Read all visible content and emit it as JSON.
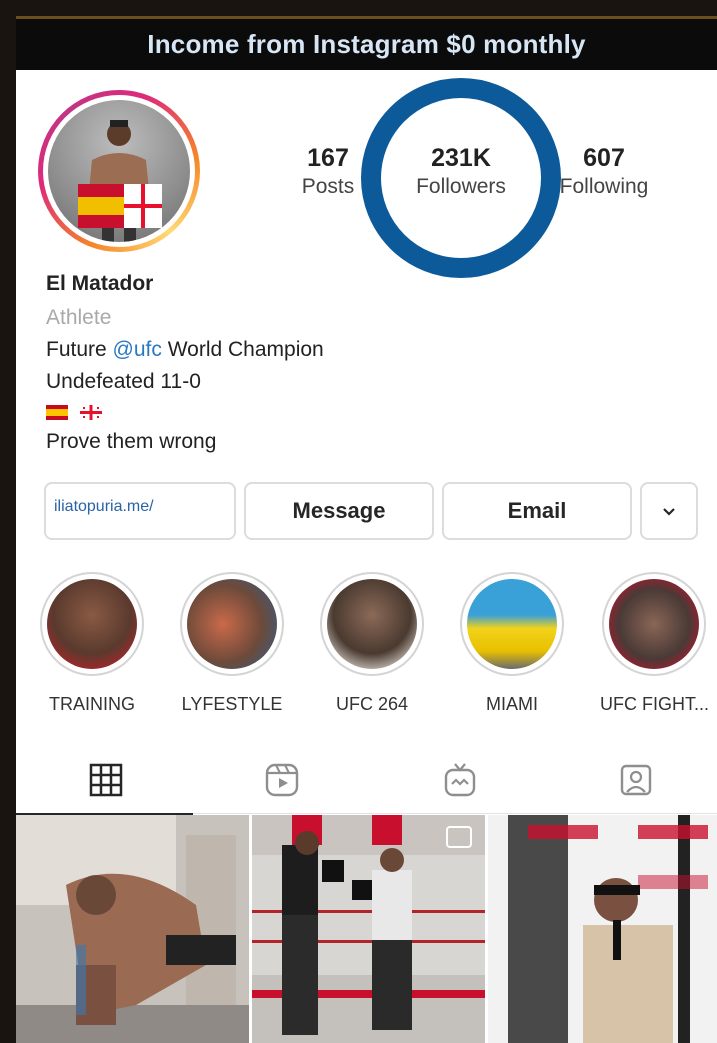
{
  "banner": {
    "text": "Income from Instagram $0 monthly"
  },
  "profile": {
    "stats": [
      {
        "value": "167",
        "label": "Posts"
      },
      {
        "value": "231K",
        "label": "Followers"
      },
      {
        "value": "607",
        "label": "Following"
      }
    ],
    "name": "El Matador",
    "category": "Athlete",
    "bio": {
      "line1_prefix": "Future ",
      "line1_mention": "@ufc",
      "line1_suffix": " World Champion",
      "line2": "Undefeated 11-0",
      "line4": "Prove them wrong"
    }
  },
  "buttons": {
    "link": "iliatopuria.me/",
    "message": "Message",
    "email": "Email",
    "more": "⌄"
  },
  "highlights": [
    {
      "label": "TRAINING"
    },
    {
      "label": "LYFESTYLE"
    },
    {
      "label": "UFC 264"
    },
    {
      "label": "MIAMI"
    },
    {
      "label": "UFC FIGHT..."
    }
  ],
  "tabs": [
    "grid-icon",
    "reels-icon",
    "igtv-icon",
    "tagged-icon"
  ],
  "colors": {
    "accent_blue": "#0d5a9b",
    "mention": "#2b78c2",
    "banner_bg": "#0b0b0b"
  }
}
